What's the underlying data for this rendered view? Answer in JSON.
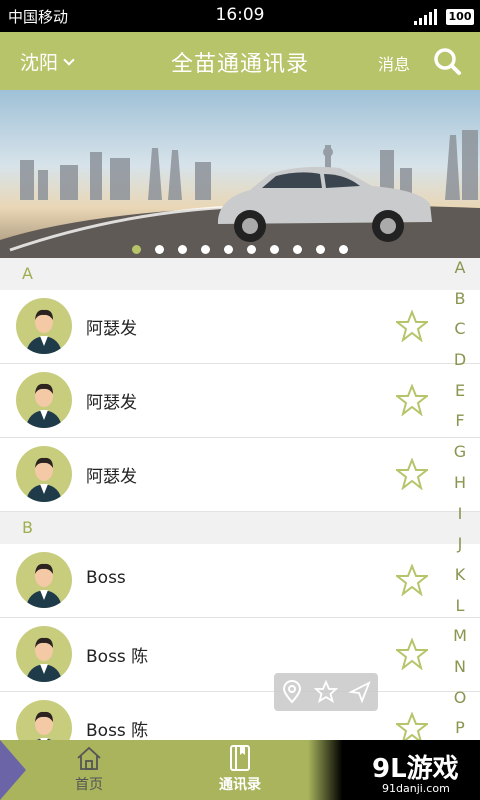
{
  "status_bar": {
    "carrier": "中国移动",
    "time": "16:09",
    "battery": "100"
  },
  "header": {
    "city": "沈阳",
    "title": "全苗通通讯录",
    "messages": "消息"
  },
  "banner": {
    "dots": 10,
    "active_dot": 0
  },
  "sections": [
    {
      "letter": "A",
      "contacts": [
        {
          "name": "阿瑟发"
        },
        {
          "name": "阿瑟发"
        },
        {
          "name": "阿瑟发"
        }
      ]
    },
    {
      "letter": "B",
      "contacts": [
        {
          "name": "Boss"
        },
        {
          "name": "Boss 陈"
        },
        {
          "name": "Boss 陈"
        }
      ]
    }
  ],
  "alphabet": [
    "A",
    "B",
    "C",
    "D",
    "E",
    "F",
    "G",
    "H",
    "I",
    "J",
    "K",
    "L",
    "M",
    "N",
    "O",
    "P"
  ],
  "bottom_nav": {
    "home": "首页",
    "contacts": "通讯录"
  },
  "watermark": {
    "title": "9L游戏",
    "domain": "91danji.com"
  },
  "colors": {
    "accent": "#b7c46a",
    "nav": "#a9b45c",
    "index_text": "#8b9550"
  }
}
